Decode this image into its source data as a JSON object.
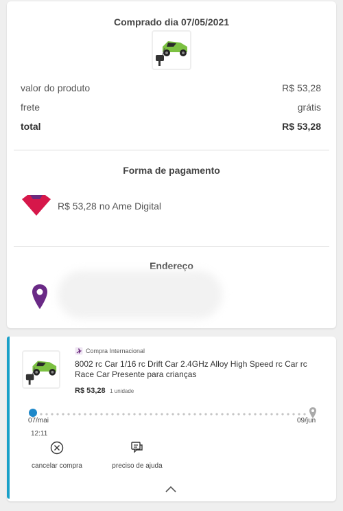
{
  "summary": {
    "purchase_date_label": "Comprado dia 07/05/2021",
    "rows": [
      {
        "label": "valor do produto",
        "value": "R$ 53,28"
      },
      {
        "label": "frete",
        "value": "grátis"
      },
      {
        "label": "total",
        "value": "R$ 53,28"
      }
    ]
  },
  "payment": {
    "title": "Forma de pagamento",
    "description": "R$ 53,28 no Ame Digital",
    "colors": {
      "ame_red": "#d6174a",
      "ame_purple": "#6c2a7e"
    }
  },
  "address": {
    "title": "Endereço",
    "pin_color": "#6a2a86"
  },
  "order": {
    "badge": "Compra Internacional",
    "product_title": "8002 rc Car 1/16 rc Drift Car 2.4GHz Alloy High Speed rc Car rc Race Car Presente para crianças",
    "price": "R$ 53,28",
    "quantity": "1 unidade",
    "timeline": {
      "start_date": "07/mai",
      "start_time": "12:11",
      "end_date": "09/jun",
      "active_color": "#1e88c9"
    },
    "actions": [
      {
        "label": "cancelar compra",
        "icon": "cancel-circle-icon"
      },
      {
        "label": "preciso de ajuda",
        "icon": "chat-help-icon"
      }
    ],
    "accent_color": "#1aa0c8"
  }
}
